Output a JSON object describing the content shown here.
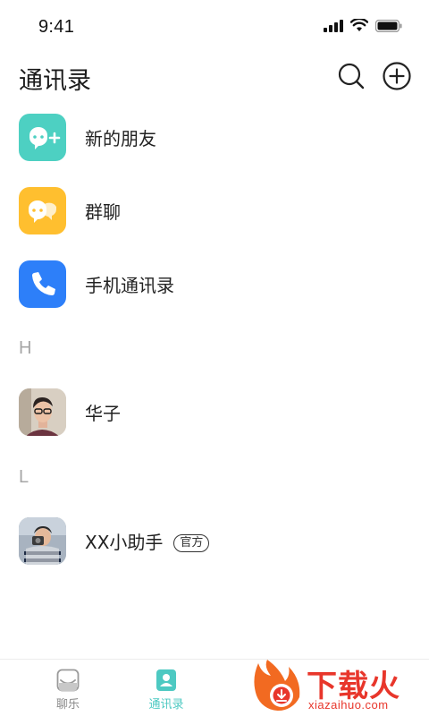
{
  "status_bar": {
    "time": "9:41"
  },
  "header": {
    "title": "通讯录"
  },
  "function_rows": [
    {
      "label": "新的朋友",
      "icon": "new-friend-icon",
      "color": "#4dd0c2"
    },
    {
      "label": "群聊",
      "icon": "group-chat-icon",
      "color": "#ffbf2f"
    },
    {
      "label": "手机通讯录",
      "icon": "phone-icon",
      "color": "#2d7ff9"
    }
  ],
  "sections": [
    {
      "letter": "H",
      "contacts": [
        {
          "name": "华子",
          "avatar": "avatar-photo"
        }
      ]
    },
    {
      "letter": "L",
      "contacts": [
        {
          "name": "XX小助手",
          "badge": "官方",
          "avatar": "avatar-photo"
        }
      ]
    }
  ],
  "tab_bar": {
    "tabs": [
      {
        "label": "聊乐",
        "icon": "chat-icon",
        "active": false
      },
      {
        "label": "通讯录",
        "icon": "contacts-icon",
        "active": true
      }
    ],
    "active_color": "#4dc9c2",
    "inactive_color": "#8a8a8a"
  },
  "watermark": {
    "text": "下载火",
    "subtext": "xiazaihuo.com"
  }
}
